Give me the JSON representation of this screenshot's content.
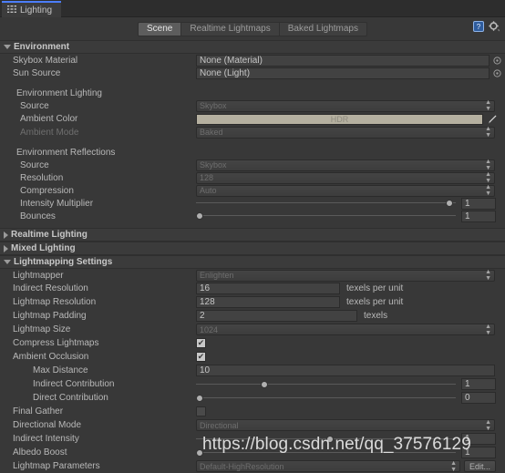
{
  "window": {
    "tab_label": "Lighting",
    "tab_icon": "lighting-icon"
  },
  "toolbar": {
    "modes": [
      {
        "label": "Scene",
        "selected": true
      },
      {
        "label": "Realtime Lightmaps",
        "selected": false
      },
      {
        "label": "Baked Lightmaps",
        "selected": false
      }
    ],
    "help_icon": "help-icon",
    "settings_icon": "gear-icon"
  },
  "sections": {
    "environment": {
      "title": "Environment",
      "expanded": true
    },
    "realtime_lighting": {
      "title": "Realtime Lighting",
      "expanded": false
    },
    "mixed_lighting": {
      "title": "Mixed Lighting",
      "expanded": false
    },
    "lightmapping_settings": {
      "title": "Lightmapping Settings",
      "expanded": true
    }
  },
  "environment": {
    "skybox_material": {
      "label": "Skybox Material",
      "value": "None (Material)"
    },
    "sun_source": {
      "label": "Sun Source",
      "value": "None (Light)"
    },
    "env_lighting_group": "Environment Lighting",
    "source": {
      "label": "Source",
      "value": "Skybox"
    },
    "ambient_color": {
      "label": "Ambient Color",
      "value": "HDR",
      "color": "#b5b0a0"
    },
    "ambient_mode": {
      "label": "Ambient Mode",
      "value": "Baked",
      "disabled": true
    },
    "env_reflections_group": "Environment Reflections",
    "refl_source": {
      "label": "Source",
      "value": "Skybox"
    },
    "resolution": {
      "label": "Resolution",
      "value": "128"
    },
    "compression": {
      "label": "Compression",
      "value": "Auto"
    },
    "intensity_multiplier": {
      "label": "Intensity Multiplier",
      "value": "1",
      "pct": 100
    },
    "bounces": {
      "label": "Bounces",
      "value": "1",
      "pct": 0
    }
  },
  "lightmapping": {
    "lightmapper": {
      "label": "Lightmapper",
      "value": "Enlighten"
    },
    "indirect_resolution": {
      "label": "Indirect Resolution",
      "value": "16",
      "unit": "texels per unit"
    },
    "lightmap_resolution": {
      "label": "Lightmap Resolution",
      "value": "128",
      "unit": "texels per unit"
    },
    "lightmap_padding": {
      "label": "Lightmap Padding",
      "value": "2",
      "unit": "texels"
    },
    "lightmap_size": {
      "label": "Lightmap Size",
      "value": "1024"
    },
    "compress_lightmaps": {
      "label": "Compress Lightmaps",
      "checked": true
    },
    "ambient_occlusion": {
      "label": "Ambient Occlusion",
      "checked": true
    },
    "max_distance": {
      "label": "Max Distance",
      "value": "10"
    },
    "indirect_contribution": {
      "label": "Indirect Contribution",
      "value": "1",
      "pct": 25
    },
    "direct_contribution": {
      "label": "Direct Contribution",
      "value": "0",
      "pct": 0
    },
    "final_gather": {
      "label": "Final Gather",
      "checked": false
    },
    "directional_mode": {
      "label": "Directional Mode",
      "value": "Directional"
    },
    "indirect_intensity": {
      "label": "Indirect Intensity",
      "value": "1",
      "pct": 50
    },
    "albedo_boost": {
      "label": "Albedo Boost",
      "value": "1",
      "pct": 0
    },
    "lightmap_parameters": {
      "label": "Lightmap Parameters",
      "value": "Default-HighResolution",
      "edit_label": "Edit..."
    }
  },
  "watermark": "https://blog.csdn.net/qq_37576129",
  "checkmark_glyph": "✔"
}
